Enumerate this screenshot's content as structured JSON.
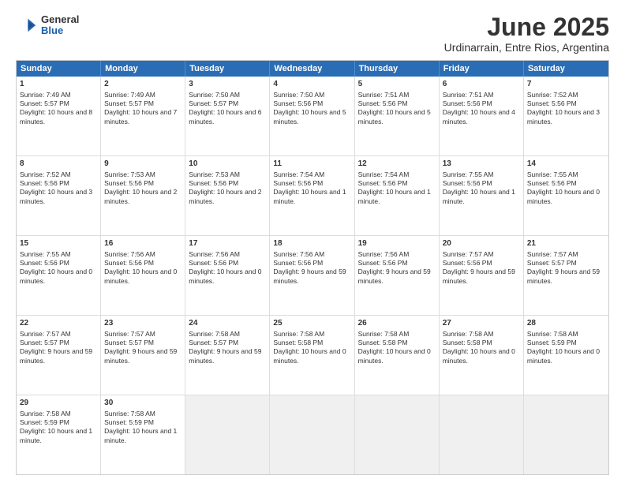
{
  "header": {
    "logo_general": "General",
    "logo_blue": "Blue",
    "month_title": "June 2025",
    "location": "Urdinarrain, Entre Rios, Argentina"
  },
  "calendar": {
    "days_of_week": [
      "Sunday",
      "Monday",
      "Tuesday",
      "Wednesday",
      "Thursday",
      "Friday",
      "Saturday"
    ],
    "rows": [
      [
        {
          "day": "1",
          "info": "Sunrise: 7:49 AM\nSunset: 5:57 PM\nDaylight: 10 hours and 8 minutes."
        },
        {
          "day": "2",
          "info": "Sunrise: 7:49 AM\nSunset: 5:57 PM\nDaylight: 10 hours and 7 minutes."
        },
        {
          "day": "3",
          "info": "Sunrise: 7:50 AM\nSunset: 5:57 PM\nDaylight: 10 hours and 6 minutes."
        },
        {
          "day": "4",
          "info": "Sunrise: 7:50 AM\nSunset: 5:56 PM\nDaylight: 10 hours and 5 minutes."
        },
        {
          "day": "5",
          "info": "Sunrise: 7:51 AM\nSunset: 5:56 PM\nDaylight: 10 hours and 5 minutes."
        },
        {
          "day": "6",
          "info": "Sunrise: 7:51 AM\nSunset: 5:56 PM\nDaylight: 10 hours and 4 minutes."
        },
        {
          "day": "7",
          "info": "Sunrise: 7:52 AM\nSunset: 5:56 PM\nDaylight: 10 hours and 3 minutes."
        }
      ],
      [
        {
          "day": "8",
          "info": "Sunrise: 7:52 AM\nSunset: 5:56 PM\nDaylight: 10 hours and 3 minutes."
        },
        {
          "day": "9",
          "info": "Sunrise: 7:53 AM\nSunset: 5:56 PM\nDaylight: 10 hours and 2 minutes."
        },
        {
          "day": "10",
          "info": "Sunrise: 7:53 AM\nSunset: 5:56 PM\nDaylight: 10 hours and 2 minutes."
        },
        {
          "day": "11",
          "info": "Sunrise: 7:54 AM\nSunset: 5:56 PM\nDaylight: 10 hours and 1 minute."
        },
        {
          "day": "12",
          "info": "Sunrise: 7:54 AM\nSunset: 5:56 PM\nDaylight: 10 hours and 1 minute."
        },
        {
          "day": "13",
          "info": "Sunrise: 7:55 AM\nSunset: 5:56 PM\nDaylight: 10 hours and 1 minute."
        },
        {
          "day": "14",
          "info": "Sunrise: 7:55 AM\nSunset: 5:56 PM\nDaylight: 10 hours and 0 minutes."
        }
      ],
      [
        {
          "day": "15",
          "info": "Sunrise: 7:55 AM\nSunset: 5:56 PM\nDaylight: 10 hours and 0 minutes."
        },
        {
          "day": "16",
          "info": "Sunrise: 7:56 AM\nSunset: 5:56 PM\nDaylight: 10 hours and 0 minutes."
        },
        {
          "day": "17",
          "info": "Sunrise: 7:56 AM\nSunset: 5:56 PM\nDaylight: 10 hours and 0 minutes."
        },
        {
          "day": "18",
          "info": "Sunrise: 7:56 AM\nSunset: 5:56 PM\nDaylight: 9 hours and 59 minutes."
        },
        {
          "day": "19",
          "info": "Sunrise: 7:56 AM\nSunset: 5:56 PM\nDaylight: 9 hours and 59 minutes."
        },
        {
          "day": "20",
          "info": "Sunrise: 7:57 AM\nSunset: 5:56 PM\nDaylight: 9 hours and 59 minutes."
        },
        {
          "day": "21",
          "info": "Sunrise: 7:57 AM\nSunset: 5:57 PM\nDaylight: 9 hours and 59 minutes."
        }
      ],
      [
        {
          "day": "22",
          "info": "Sunrise: 7:57 AM\nSunset: 5:57 PM\nDaylight: 9 hours and 59 minutes."
        },
        {
          "day": "23",
          "info": "Sunrise: 7:57 AM\nSunset: 5:57 PM\nDaylight: 9 hours and 59 minutes."
        },
        {
          "day": "24",
          "info": "Sunrise: 7:58 AM\nSunset: 5:57 PM\nDaylight: 9 hours and 59 minutes."
        },
        {
          "day": "25",
          "info": "Sunrise: 7:58 AM\nSunset: 5:58 PM\nDaylight: 10 hours and 0 minutes."
        },
        {
          "day": "26",
          "info": "Sunrise: 7:58 AM\nSunset: 5:58 PM\nDaylight: 10 hours and 0 minutes."
        },
        {
          "day": "27",
          "info": "Sunrise: 7:58 AM\nSunset: 5:58 PM\nDaylight: 10 hours and 0 minutes."
        },
        {
          "day": "28",
          "info": "Sunrise: 7:58 AM\nSunset: 5:59 PM\nDaylight: 10 hours and 0 minutes."
        }
      ],
      [
        {
          "day": "29",
          "info": "Sunrise: 7:58 AM\nSunset: 5:59 PM\nDaylight: 10 hours and 1 minute."
        },
        {
          "day": "30",
          "info": "Sunrise: 7:58 AM\nSunset: 5:59 PM\nDaylight: 10 hours and 1 minute."
        },
        {
          "day": "",
          "info": ""
        },
        {
          "day": "",
          "info": ""
        },
        {
          "day": "",
          "info": ""
        },
        {
          "day": "",
          "info": ""
        },
        {
          "day": "",
          "info": ""
        }
      ]
    ]
  }
}
